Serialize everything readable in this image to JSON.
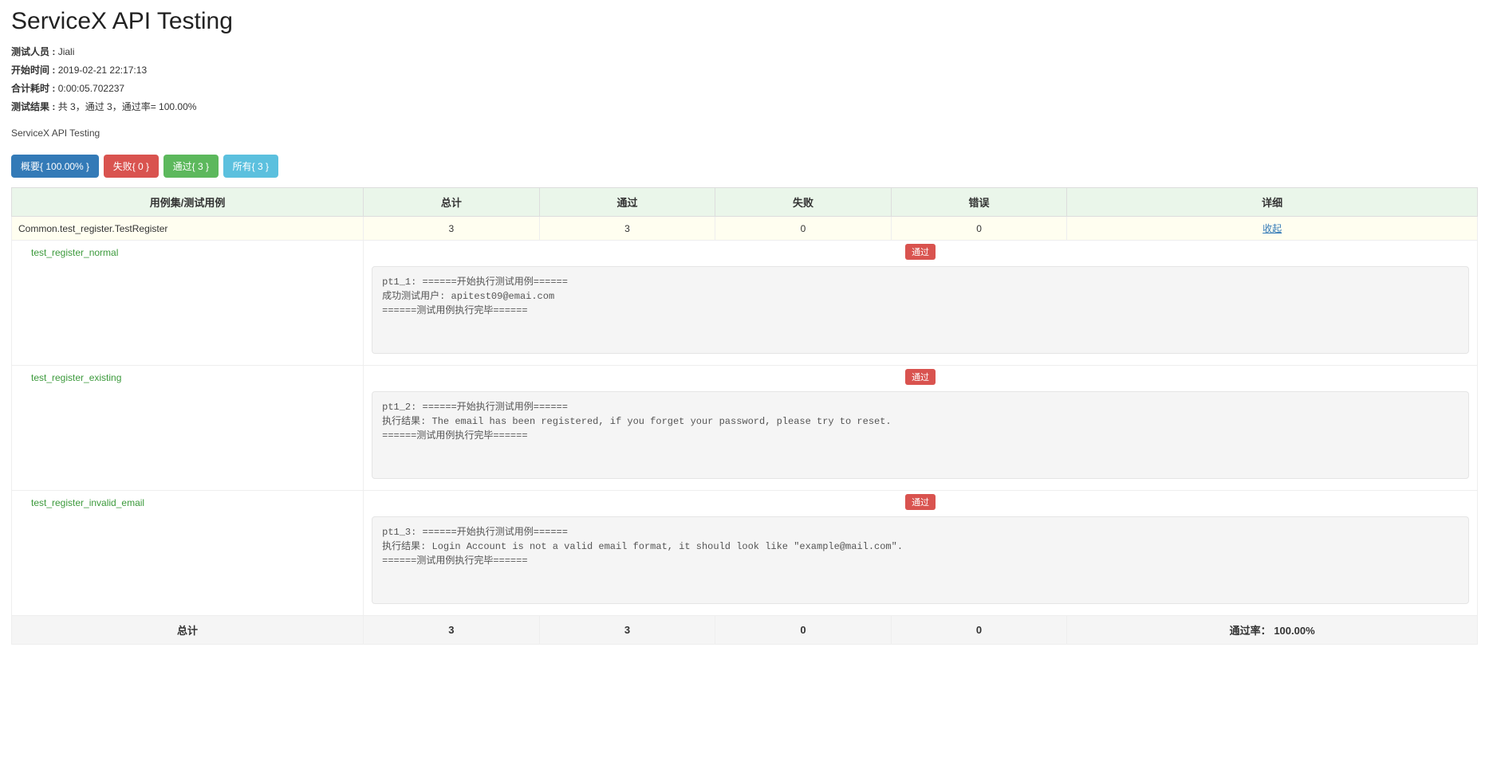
{
  "header": {
    "title": "ServiceX API Testing",
    "tester_label": "测试人员 :",
    "tester_value": "Jiali",
    "start_label": "开始时间 :",
    "start_value": "2019-02-21 22:17:13",
    "duration_label": "合计耗时 :",
    "duration_value": "0:00:05.702237",
    "result_label": "测试结果 :",
    "result_value": "共 3，通过 3，通过率= 100.00%",
    "subtitle": "ServiceX API Testing"
  },
  "buttons": {
    "summary": "概要{ 100.00% }",
    "failed": "失败{ 0 }",
    "passed": "通过{ 3 }",
    "all": "所有{ 3 }"
  },
  "columns": {
    "suite": "用例集/测试用例",
    "total": "总计",
    "pass": "通过",
    "fail": "失败",
    "error": "错误",
    "detail": "详细"
  },
  "suite": {
    "name": "Common.test_register.TestRegister",
    "total": "3",
    "pass": "3",
    "fail": "0",
    "error": "0",
    "detail_link": "收起"
  },
  "tests": [
    {
      "name": "test_register_normal",
      "status": "通过",
      "log": "pt1_1: ======开始执行测试用例======\n成功测试用户: apitest09@emai.com\n======测试用例执行完毕======"
    },
    {
      "name": "test_register_existing",
      "status": "通过",
      "log": "pt1_2: ======开始执行测试用例======\n执行结果: The email has been registered, if you forget your password, please try to reset.\n======测试用例执行完毕======"
    },
    {
      "name": "test_register_invalid_email",
      "status": "通过",
      "log": "pt1_3: ======开始执行测试用例======\n执行结果: Login Account is not a valid email format, it should look like \"example@mail.com\".\n======测试用例执行完毕======"
    }
  ],
  "footer": {
    "label": "总计",
    "total": "3",
    "pass": "3",
    "fail": "0",
    "error": "0",
    "rate_label": "通过率：",
    "rate_value": "100.00%"
  }
}
